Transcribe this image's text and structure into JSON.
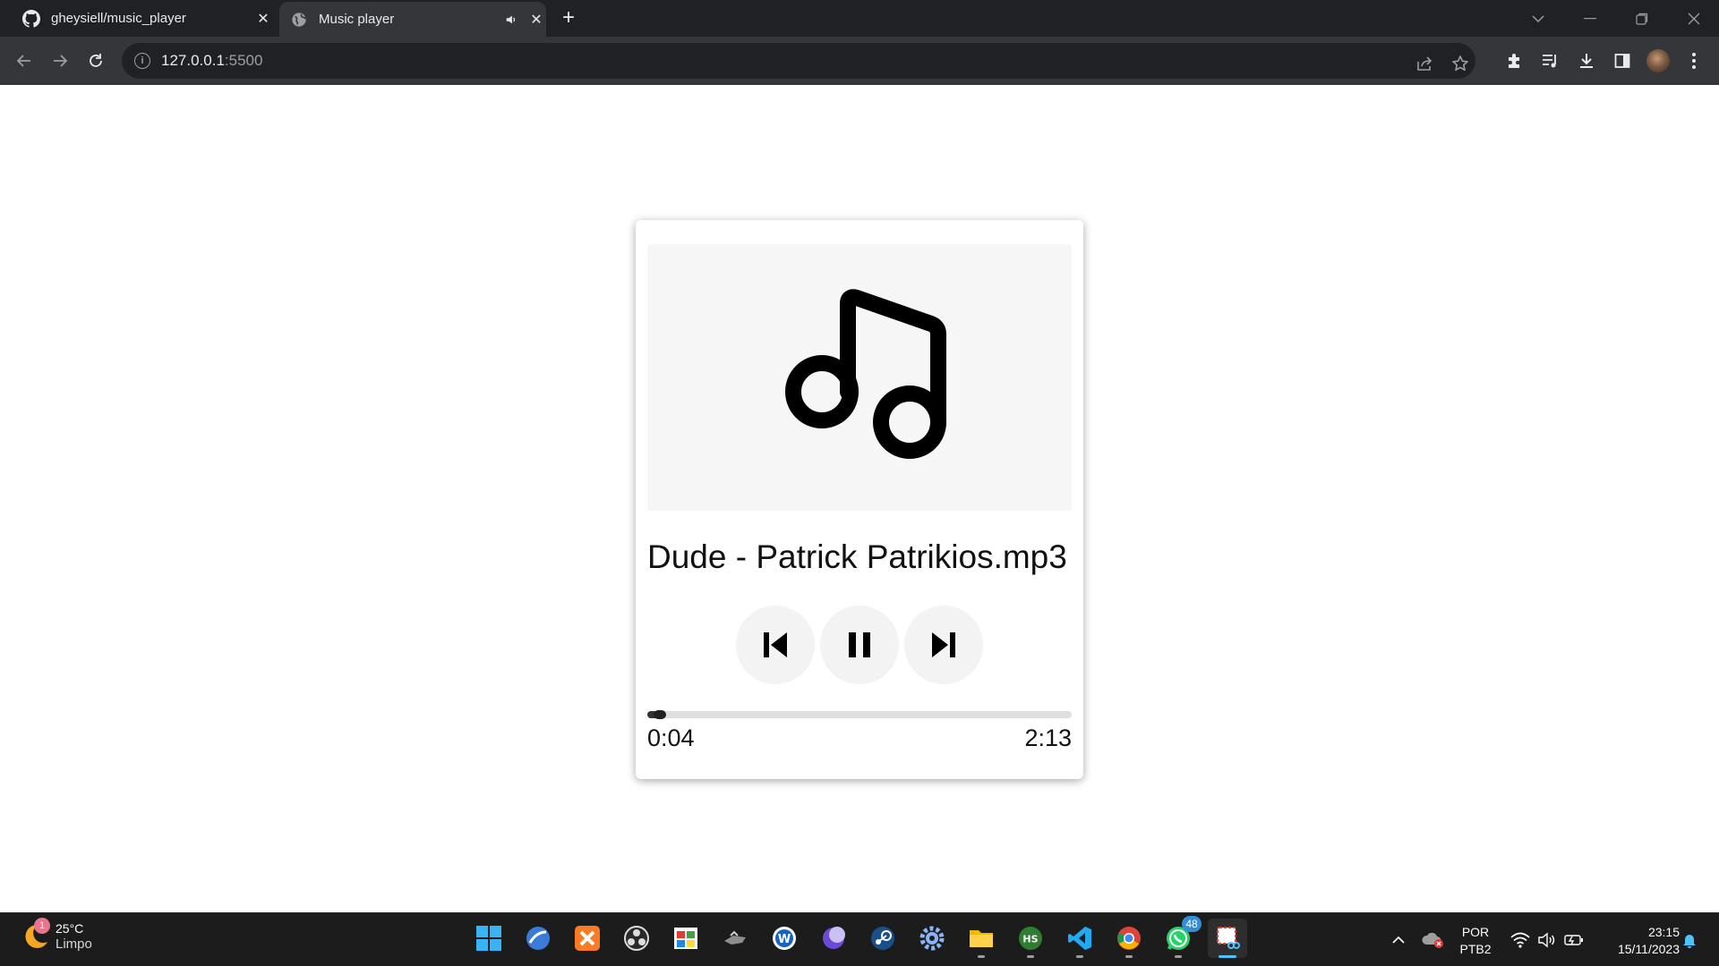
{
  "browser": {
    "tabs": [
      {
        "title": "gheysiell/music_player",
        "icon": "github-icon",
        "active": false
      },
      {
        "title": "Music player",
        "icon": "globe-icon",
        "active": true,
        "audio_icon": "speaker-icon"
      }
    ],
    "address": {
      "host": "127.0.0.1",
      "port": ":5500"
    }
  },
  "player": {
    "cover_icon": "music-note-icon",
    "song_title": "Dude - Patrick Patrikios.mp3",
    "controls": [
      "previous-track-icon",
      "pause-icon",
      "next-track-icon"
    ],
    "progress_fraction": 0.03,
    "current_time": "0:04",
    "duration": "2:13"
  },
  "taskbar": {
    "weather": {
      "temp": "25°C",
      "condition": "Limpo",
      "badge": "1"
    },
    "whatsapp_badge": "48",
    "language": {
      "line1": "POR",
      "line2": "PTB2"
    },
    "clock": {
      "time": "23:15",
      "date": "15/11/2023"
    }
  },
  "colors": {
    "chrome_dark": "#202124",
    "chrome_toolbar": "#35363a",
    "taskbar": "#1c1c1c",
    "accent": "#4cc2ff"
  }
}
